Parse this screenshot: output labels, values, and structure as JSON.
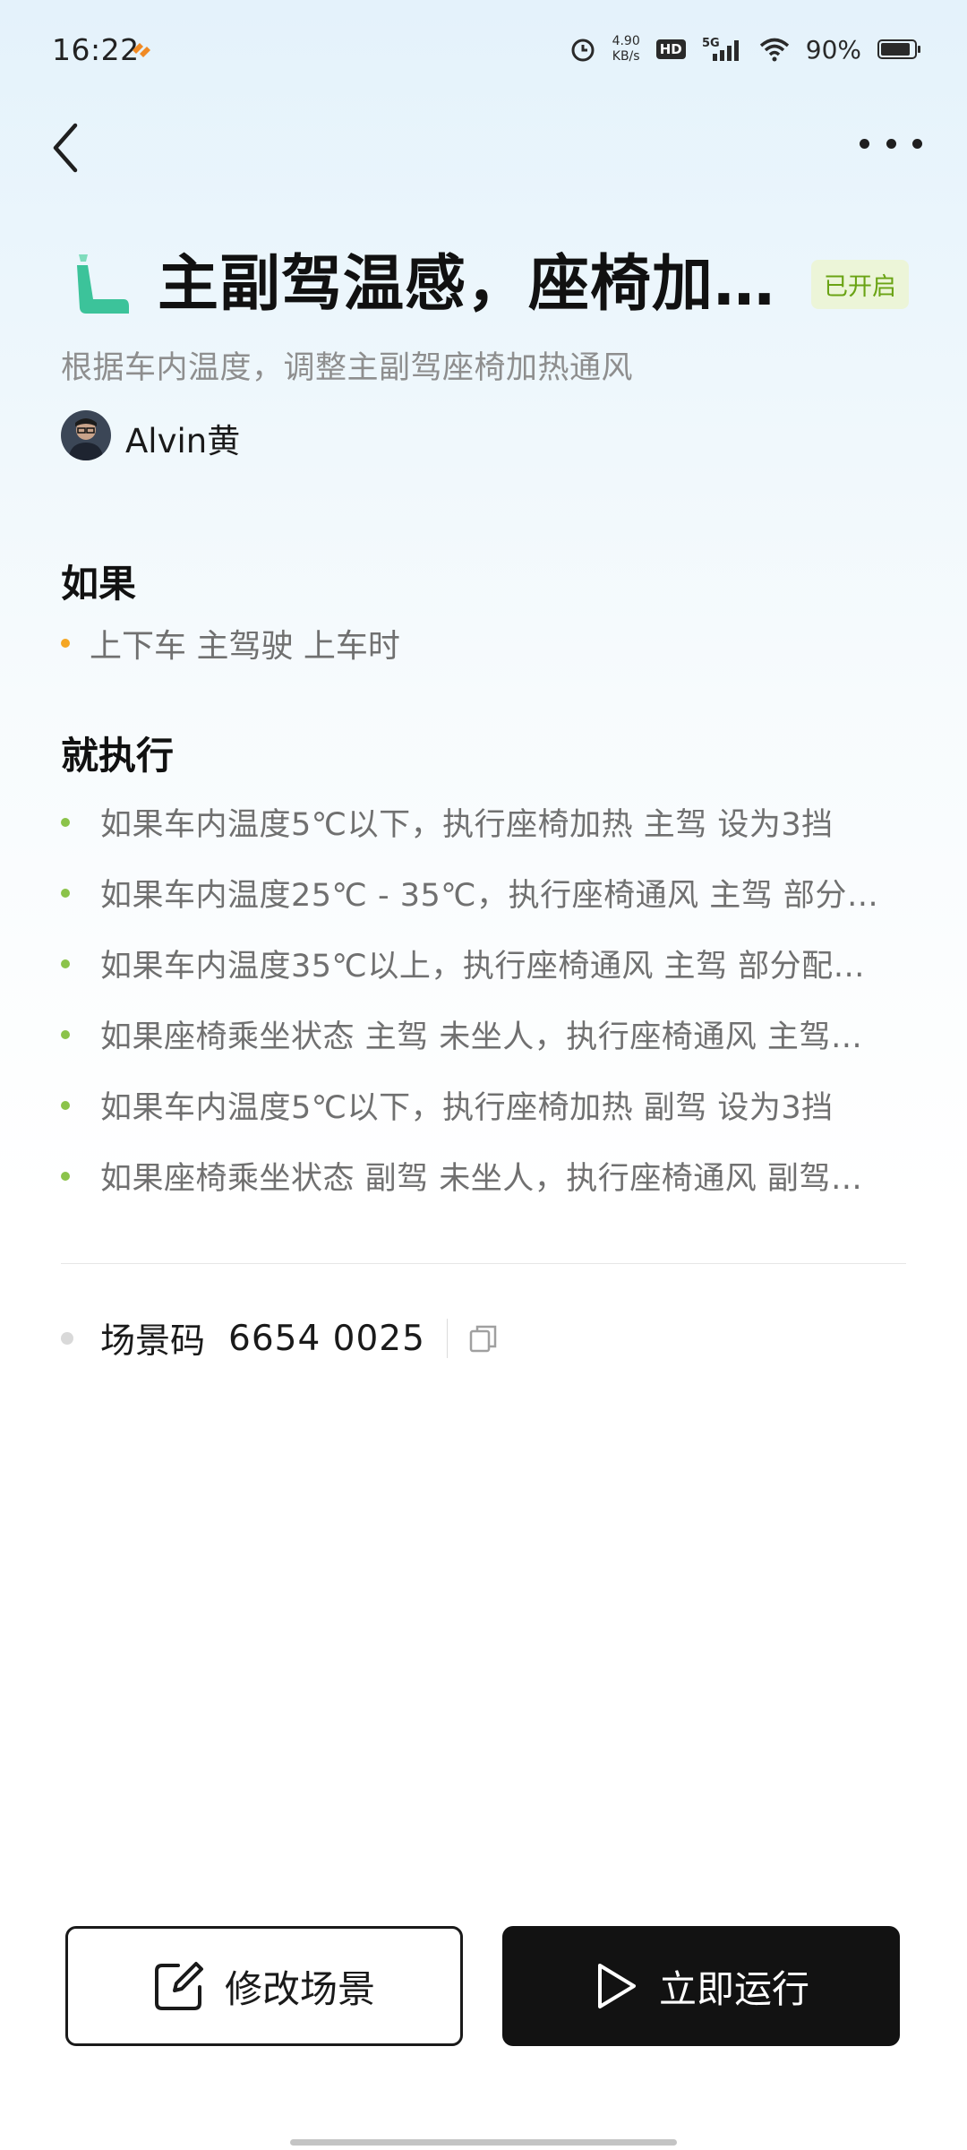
{
  "status_bar": {
    "time": "16:22",
    "net_speed_value": "4.90",
    "net_speed_unit": "KB/s",
    "hd": "HD",
    "network": "5G",
    "battery_percent": "90%",
    "battery_level": 0.9
  },
  "scene": {
    "title": "主副驾温感，座椅加热通风",
    "status": "已开启",
    "description": "根据车内温度，调整主副驾座椅加热通风",
    "author": "Alvin黄",
    "icon": "car-seat-icon",
    "accent_color": "#3cc39a"
  },
  "condition": {
    "title": "如果",
    "items": [
      "上下车 主驾驶 上车时"
    ]
  },
  "actions": {
    "title": "就执行",
    "items": [
      "如果车内温度5℃以下，执行座椅加热 主驾 设为3挡",
      "如果车内温度25℃ - 35℃，执行座椅通风 主驾 部分…",
      "如果车内温度35℃以上，执行座椅通风 主驾 部分配…",
      "如果座椅乘坐状态 主驾 未坐人，执行座椅通风 主驾…",
      "如果车内温度5℃以下，执行座椅加热 副驾 设为3挡",
      "如果座椅乘坐状态 副驾 未坐人，执行座椅通风 副驾…"
    ]
  },
  "scene_code": {
    "label": "场景码",
    "value": "6654 0025"
  },
  "buttons": {
    "edit": "修改场景",
    "run": "立即运行"
  }
}
